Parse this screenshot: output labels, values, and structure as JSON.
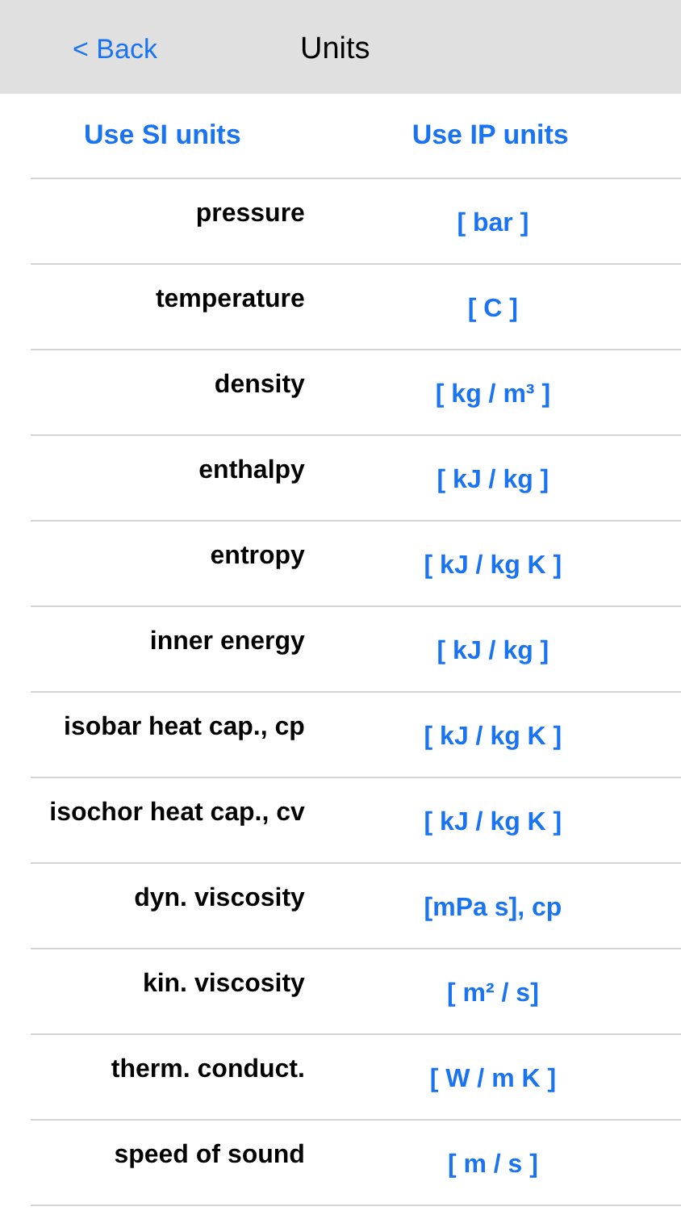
{
  "nav": {
    "back": "< Back",
    "title": "Units"
  },
  "unit_systems": [
    "Use SI units",
    "Use IP units"
  ],
  "rows": [
    {
      "quantity": "pressure",
      "unit": "[ bar ]"
    },
    {
      "quantity": "temperature",
      "unit": "[ C ]"
    },
    {
      "quantity": "density",
      "unit": "[ kg / m³ ]"
    },
    {
      "quantity": "enthalpy",
      "unit": "[ kJ / kg ]"
    },
    {
      "quantity": "entropy",
      "unit": "[ kJ / kg K ]"
    },
    {
      "quantity": "inner energy",
      "unit": "[ kJ / kg ]"
    },
    {
      "quantity": "isobar heat cap., cp",
      "unit": "[ kJ / kg K ]"
    },
    {
      "quantity": "isochor heat cap., cv",
      "unit": "[ kJ / kg K ]"
    },
    {
      "quantity": "dyn. viscosity",
      "unit": "[mPa s], cp"
    },
    {
      "quantity": "kin. viscosity",
      "unit": "[ m² / s]"
    },
    {
      "quantity": "therm. conduct.",
      "unit": "[ W / m K ]"
    },
    {
      "quantity": "speed of sound",
      "unit": "[ m / s ]"
    }
  ]
}
